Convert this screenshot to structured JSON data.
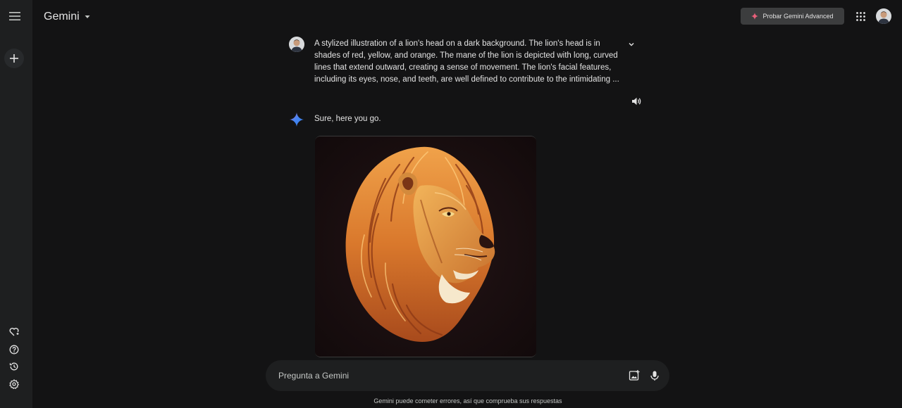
{
  "header": {
    "app_title": "Gemini",
    "advanced_label": "Probar Gemini Advanced"
  },
  "conversation": {
    "prompt": "A stylized illustration of a lion's head on a dark background. The lion's head is in shades of red, yellow, and orange. The mane of the lion is depicted with long, curved lines that extend outward, creating a sense of movement. The lion's facial features, including its eyes, nose, and teeth, are well defined to contribute to the intimidating ...",
    "reply": "Sure, here you go."
  },
  "input": {
    "placeholder": "Pregunta a Gemini"
  },
  "footer": {
    "disclaimer": "Gemini puede cometer errores, así que comprueba sus respuestas"
  },
  "colors": {
    "background": "#131314",
    "sidebar": "#1e1f20",
    "accent_spark": "#4285f4",
    "advanced_spark": "#e8607a"
  }
}
